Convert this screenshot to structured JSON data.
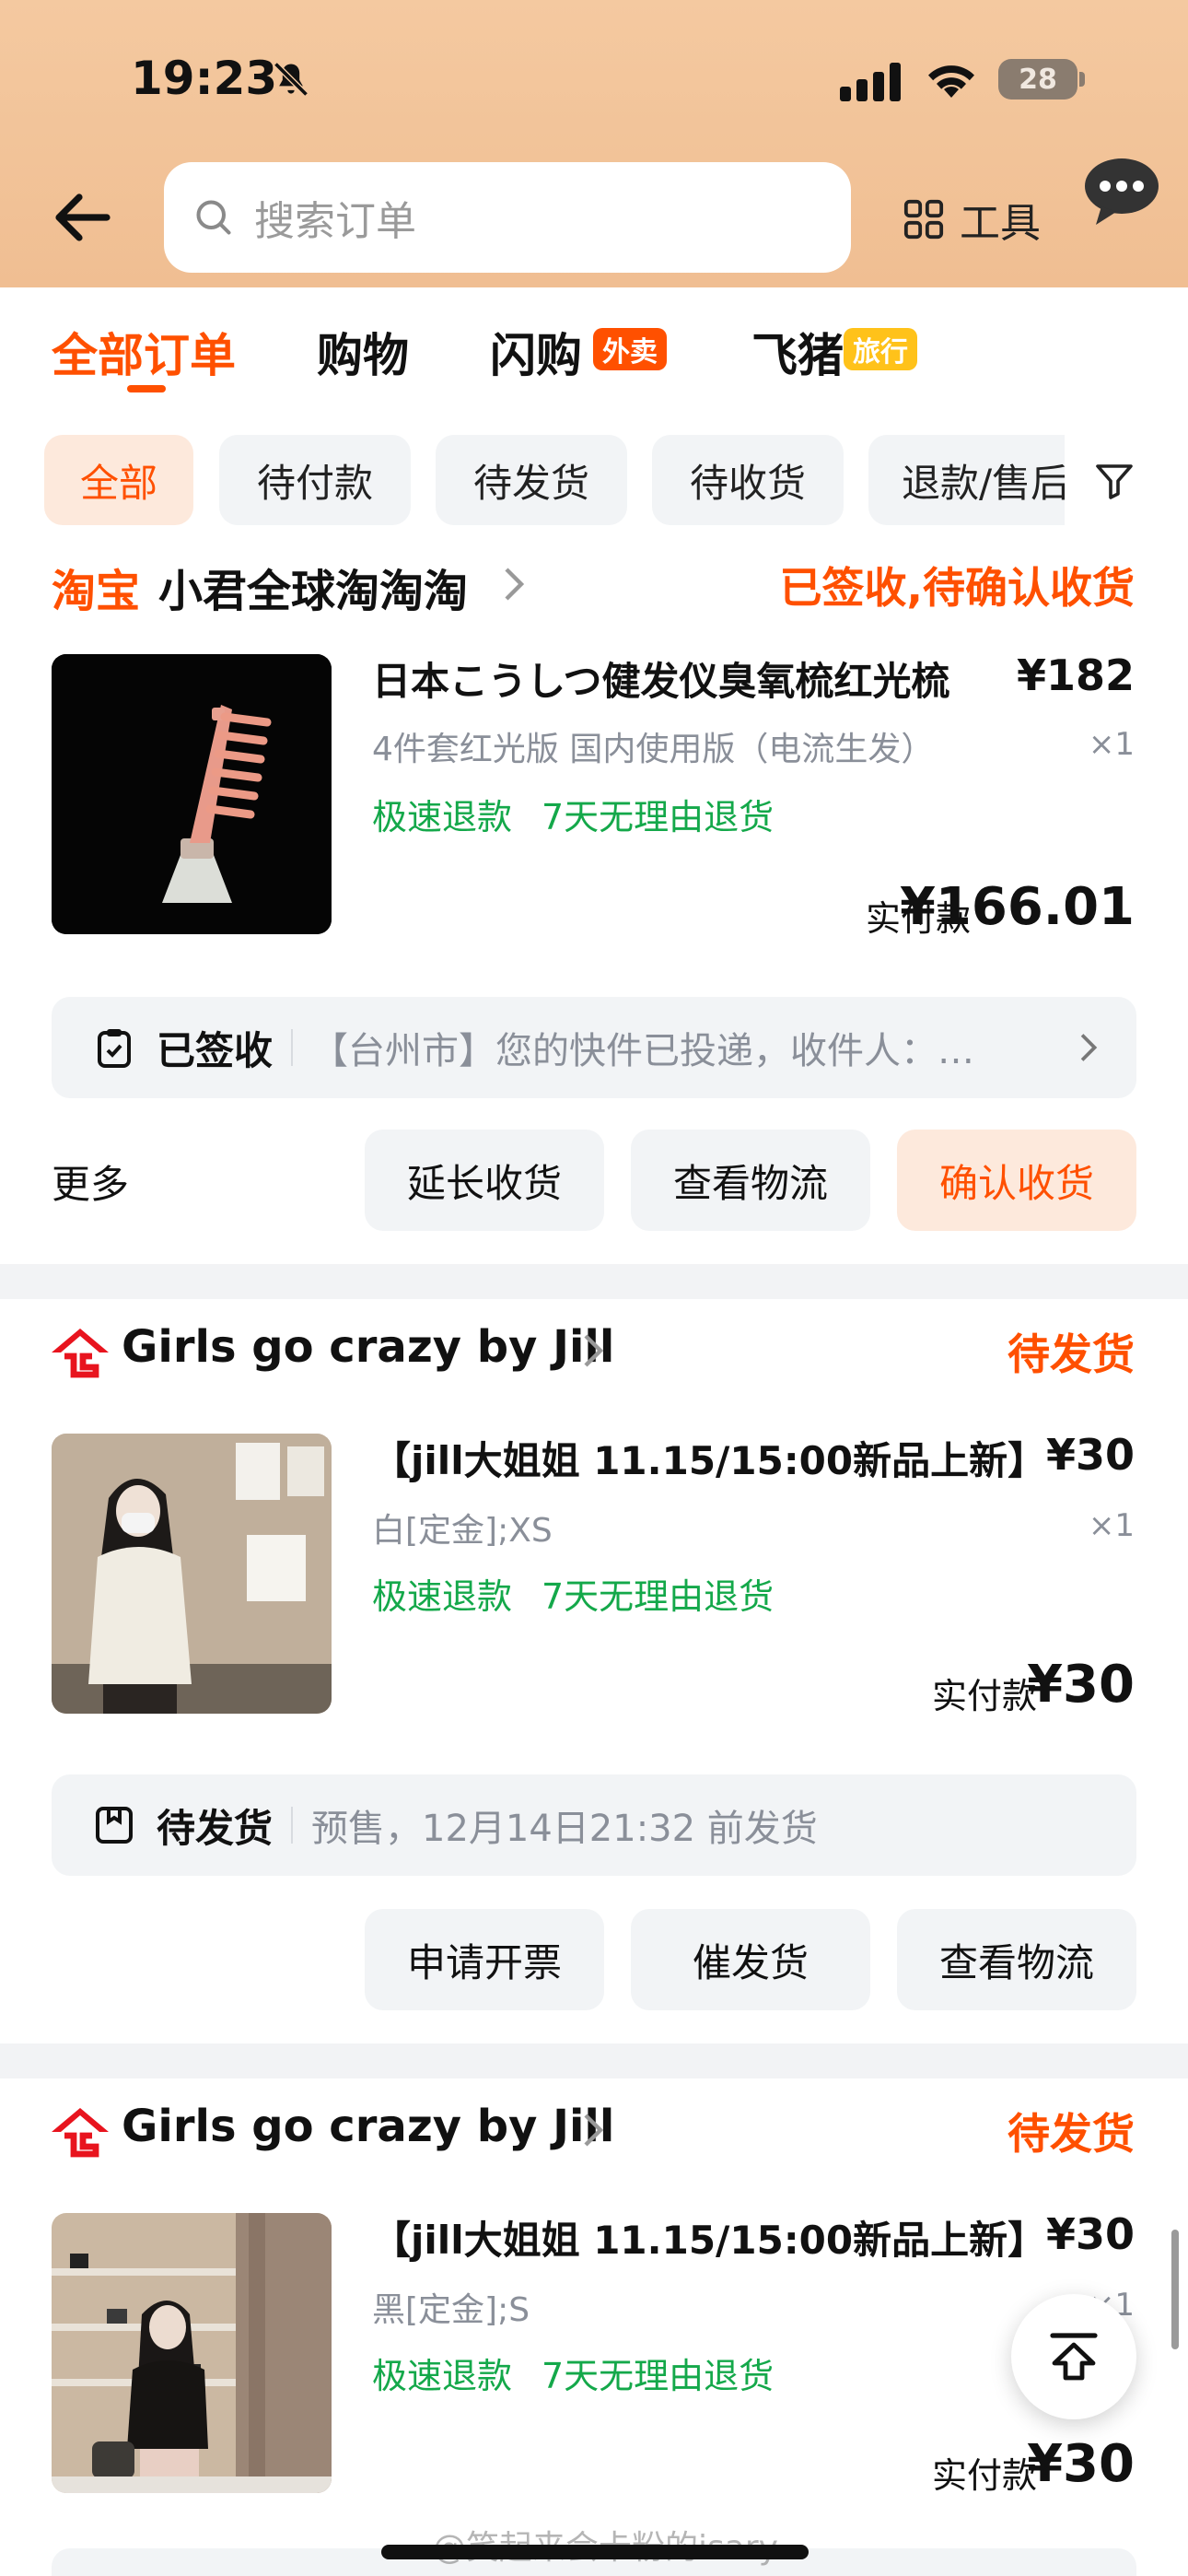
{
  "status_bar": {
    "time": "19:23",
    "battery": "28"
  },
  "header": {
    "search_placeholder": "搜索订单",
    "tools_label": "工具"
  },
  "tabs": [
    {
      "label": "全部订单",
      "active": true
    },
    {
      "label": "购物"
    },
    {
      "label": "闪购",
      "badge": "外卖",
      "badge_color": "#ff5000"
    },
    {
      "label": "飞猪",
      "badge": "旅行",
      "badge_color": "#ffc21a"
    }
  ],
  "filters": [
    "全部",
    "待付款",
    "待发货",
    "待收货",
    "退款/售后"
  ],
  "orders": [
    {
      "platform_logo": "淘宝",
      "shop": "小君全球淘淘淘",
      "status": "已签收,待确认收货",
      "title": "日本こうしつ健发仪臭氧梳红光梳",
      "price": "¥182",
      "variant": "4件套红光版 国内使用版（电流生发）",
      "qty": "×1",
      "tags": [
        "极速退款",
        "7天无理由退货"
      ],
      "paid_label": "实付款",
      "paid_amount": "¥166.01",
      "logistics_status": "已签收",
      "logistics_msg": "【台州市】您的快件已投递，收件人：…",
      "more": "更多",
      "buttons": [
        "延长收货",
        "查看物流",
        "确认收货"
      ]
    },
    {
      "platform_logo": "企",
      "shop": "Girls go crazy by Jill",
      "status": "待发货",
      "title": "【jill大姐姐 11.15/15:00新品上新】",
      "price": "¥30",
      "variant": "白[定金];XS",
      "qty": "×1",
      "tags": [
        "极速退款",
        "7天无理由退货"
      ],
      "paid_label": "实付款",
      "paid_amount": "¥30",
      "logistics_status": "待发货",
      "logistics_msg": "预售，12月14日21:32 前发货",
      "buttons": [
        "申请开票",
        "催发货",
        "查看物流"
      ]
    },
    {
      "platform_logo": "企",
      "shop": "Girls go crazy by Jill",
      "status": "待发货",
      "title": "【jill大姐姐 11.15/15:00新品上新】",
      "price": "¥30",
      "variant": "黑[定金];S",
      "qty": "×1",
      "tags": [
        "极速退款",
        "7天无理由退货"
      ],
      "paid_label": "实付款",
      "paid_amount": "¥30"
    }
  ],
  "watermark": "@笑起来会卡粉的isary",
  "colors": {
    "accent": "#ff5000",
    "green": "#14a84a",
    "header_bg": "#f0be92"
  }
}
